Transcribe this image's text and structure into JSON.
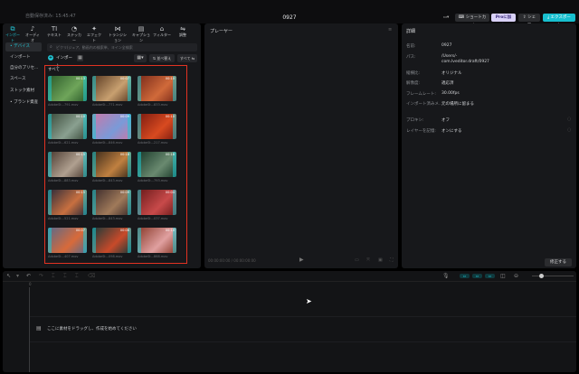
{
  "header": {
    "autosave": "自動保存済み: 15:45:47",
    "project_title": "0927",
    "layout_icon": "layout-icon",
    "shortcut": "ショートカット",
    "pro": "Proに加入",
    "share": "シェア",
    "export": "エクスポート"
  },
  "tabs": [
    {
      "icon": "import-icon",
      "label": "インポート"
    },
    {
      "icon": "audio-icon",
      "label": "オーディオ"
    },
    {
      "icon": "text-icon",
      "label": "テキスト"
    },
    {
      "icon": "sticker-icon",
      "label": "ステッカー"
    },
    {
      "icon": "effect-icon",
      "label": "エフェクト"
    },
    {
      "icon": "transition-icon",
      "label": "トランジション"
    },
    {
      "icon": "caption-icon",
      "label": "キャプション"
    },
    {
      "icon": "filter-icon",
      "label": "フィルター"
    },
    {
      "icon": "adjust-icon",
      "label": "調整"
    }
  ],
  "categories": [
    "• デバイス",
    "インポート",
    "自分のプリセ...",
    "スペース",
    "ストック素材",
    "• ブランド資産"
  ],
  "media": {
    "search_placeholder": "ピクリ(ジュア、動画内の検索単、ヨイン全検索",
    "import_label": "インポート",
    "sort_label": "並べ替え",
    "filter_label": "すべて",
    "section_label": "すべて",
    "items": [
      {
        "name": "AdobeSt...791.mov",
        "duration": "00:13",
        "colors": [
          "#2b5a2a",
          "#6fa55a"
        ]
      },
      {
        "name": "AdobeSt...771.mov",
        "duration": "00:07",
        "colors": [
          "#5a3a22",
          "#c8a070"
        ]
      },
      {
        "name": "AdobeSt...833.mov",
        "duration": "00:10",
        "colors": [
          "#7a2a1a",
          "#d06a3a"
        ]
      },
      {
        "name": "AdobeSt...621.mov",
        "duration": "00:10",
        "colors": [
          "#3a4a3a",
          "#8aa090"
        ]
      },
      {
        "name": "AdobeSt...846.mov",
        "duration": "00:09",
        "colors": [
          "#c878a8",
          "#7a9ad8"
        ]
      },
      {
        "name": "AdobeSt...217.mov",
        "duration": "00:10",
        "colors": [
          "#7a1a10",
          "#d84a20"
        ]
      },
      {
        "name": "AdobeSt...883.mov",
        "duration": "00:15",
        "colors": [
          "#4a3a30",
          "#b0a090"
        ]
      },
      {
        "name": "AdobeSt...843.mov",
        "duration": "00:18",
        "colors": [
          "#3a2a1a",
          "#c08040"
        ]
      },
      {
        "name": "AdobeSt...793.mov",
        "duration": "00:18",
        "colors": [
          "#1a3a2a",
          "#6a8a70"
        ]
      },
      {
        "name": "AdobeSt...521.mov",
        "duration": "00:15",
        "colors": [
          "#2a2a3a",
          "#c87040"
        ]
      },
      {
        "name": "AdobeSt...843.mov",
        "duration": "00:09",
        "colors": [
          "#3a2a2a",
          "#a07a5a"
        ]
      },
      {
        "name": "AdobeSt...037.mov",
        "duration": "00:04",
        "colors": [
          "#6a1a1a",
          "#c84a4a"
        ]
      },
      {
        "name": "AdobeSt...407.mov",
        "duration": "00:07",
        "colors": [
          "#5a6a8a",
          "#d86a3a"
        ]
      },
      {
        "name": "AdobeSt...098.mov",
        "duration": "00:06",
        "colors": [
          "#1a3a3a",
          "#c84a2a"
        ]
      },
      {
        "name": "AdobeSt...868.mov",
        "duration": "00:10",
        "colors": [
          "#8a3a2a",
          "#e0a0a0"
        ]
      }
    ]
  },
  "player": {
    "title": "プレーヤー",
    "timecode": "00:00:00:00 / 00:00:00:00"
  },
  "details": {
    "title": "詳細",
    "rows": [
      {
        "label": "名前:",
        "value": "0927"
      },
      {
        "label": "パス:",
        "value": "/Users/-"
      },
      {
        "label": "",
        "value": "com.lveditor.draft/0927"
      },
      {
        "label": "縦横比:",
        "value": "オリジナル"
      },
      {
        "label": "解像度:",
        "value": "適応済"
      },
      {
        "label": "フレームレート:",
        "value": "30.00fps"
      },
      {
        "label": "インポート済みメ...",
        "value": "元の場所に留まる"
      },
      {
        "label": "プロキシ:",
        "value": "オフ"
      },
      {
        "label": "レイヤーを記憶:",
        "value": "オンにする"
      }
    ],
    "modify_label": "修正する"
  },
  "timeline": {
    "ruler_zero": "0",
    "drop_hint": "ここに素材をドラッグし、作成を始めてください"
  }
}
